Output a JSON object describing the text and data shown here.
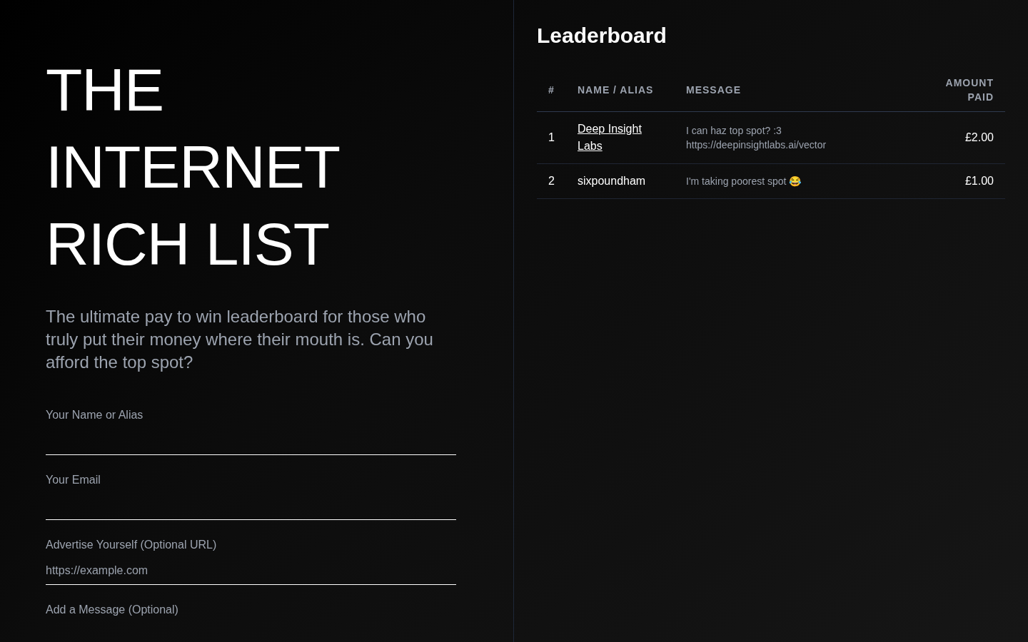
{
  "hero": {
    "title": "THE INTERNET RICH LIST",
    "subtitle": "The ultimate pay to win leaderboard for those who truly put their money where their mouth is. Can you afford the top spot?"
  },
  "form": {
    "fields": [
      {
        "kind": "input",
        "label": "Your Name or Alias"
      },
      {
        "kind": "input",
        "label": "Your Email"
      },
      {
        "kind": "input",
        "label": "Advertise Yourself (Optional URL)",
        "placeholder": "https://example.com"
      },
      {
        "kind": "textarea",
        "label": "Add a Message (Optional)"
      }
    ]
  },
  "leaderboard": {
    "title": "Leaderboard",
    "columns": [
      "#",
      "NAME / ALIAS",
      "MESSAGE",
      "AMOUNT PAID"
    ],
    "rows": [
      {
        "rank": "1",
        "name": "Deep Insight Labs",
        "linked": true,
        "message": "I can haz top spot? :3",
        "url": "https://deepinsightlabs.ai/vector",
        "amount": "£2.00"
      },
      {
        "rank": "2",
        "name": "sixpoundham",
        "linked": false,
        "message": "I'm taking poorest spot 😂",
        "amount": "£1.00"
      }
    ]
  }
}
